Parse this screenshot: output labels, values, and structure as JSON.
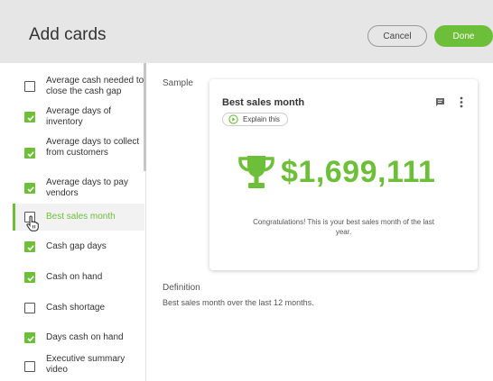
{
  "header": {
    "title": "Add cards",
    "cancel_label": "Cancel",
    "done_label": "Done"
  },
  "colors": {
    "accent": "#6dbf3a",
    "header_bg": "#e6e6e6"
  },
  "sidebar": {
    "items": [
      {
        "label": "Average cash needed to close the cash gap",
        "checked": false,
        "active": false
      },
      {
        "label": "Average days of inventory",
        "checked": true,
        "active": false
      },
      {
        "label": "Average days to collect from customers",
        "checked": true,
        "active": false
      },
      {
        "label": "Average days to pay vendors",
        "checked": true,
        "active": false
      },
      {
        "label": "Best sales month",
        "checked": false,
        "active": true
      },
      {
        "label": "Cash gap days",
        "checked": true,
        "active": false
      },
      {
        "label": "Cash on hand",
        "checked": true,
        "active": false
      },
      {
        "label": "Cash shortage",
        "checked": false,
        "active": false
      },
      {
        "label": "Days cash on hand",
        "checked": true,
        "active": false
      },
      {
        "label": "Executive summary video",
        "checked": false,
        "active": false
      }
    ]
  },
  "sample": {
    "label": "Sample",
    "card": {
      "title": "Best sales month",
      "explain_label": "Explain this",
      "amount": "$1,699,111",
      "message": "Congratulations! This is your best sales month of the last year.",
      "icons": [
        "play-circle-icon",
        "comment-icon",
        "kebab-menu-icon",
        "trophy-icon"
      ]
    }
  },
  "definition": {
    "label": "Definition",
    "text": "Best sales month over the last 12 months."
  }
}
